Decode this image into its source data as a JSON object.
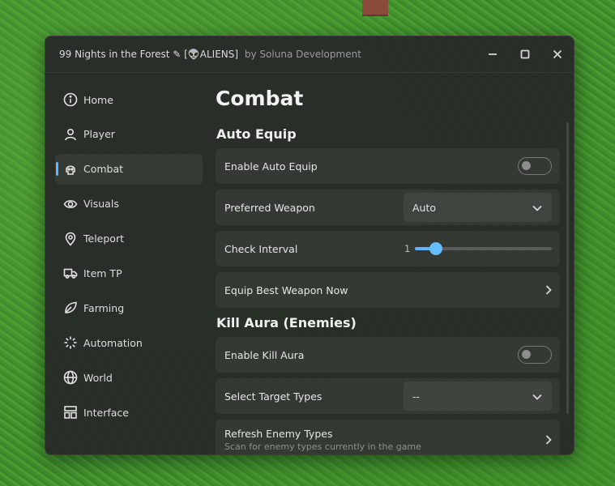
{
  "window": {
    "title": "99 Nights in the Forest ✎ [👽ALIENS]",
    "subtitle": "by Soluna Development"
  },
  "sidebar": {
    "items": [
      {
        "label": "Home",
        "icon": "info-icon"
      },
      {
        "label": "Player",
        "icon": "user-icon"
      },
      {
        "label": "Combat",
        "icon": "skull-icon",
        "active": true
      },
      {
        "label": "Visuals",
        "icon": "eye-icon"
      },
      {
        "label": "Teleport",
        "icon": "map-pin-icon"
      },
      {
        "label": "Item TP",
        "icon": "truck-icon"
      },
      {
        "label": "Farming",
        "icon": "leaf-icon"
      },
      {
        "label": "Automation",
        "icon": "loader-icon"
      },
      {
        "label": "World",
        "icon": "globe-icon"
      },
      {
        "label": "Interface",
        "icon": "layout-icon"
      }
    ]
  },
  "main": {
    "page_title": "Combat",
    "sections": [
      {
        "title": "Auto Equip",
        "rows": {
          "enable_auto_equip": {
            "label": "Enable Auto Equip",
            "value": false
          },
          "preferred_weapon": {
            "label": "Preferred Weapon",
            "value": "Auto"
          },
          "check_interval": {
            "label": "Check Interval",
            "value": "1",
            "fraction": 0.15
          },
          "equip_best": {
            "label": "Equip Best Weapon Now"
          }
        }
      },
      {
        "title": "Kill Aura (Enemies)",
        "rows": {
          "enable_kill_aura": {
            "label": "Enable Kill Aura",
            "value": false
          },
          "select_target_types": {
            "label": "Select Target Types",
            "value": "--"
          },
          "refresh_enemy_types": {
            "label": "Refresh Enemy Types",
            "description": "Scan for enemy types currently in the game"
          }
        }
      }
    ]
  },
  "colors": {
    "accent": "#5fb6ff",
    "window_bg": "#282b28",
    "row_bg": "#363936"
  }
}
